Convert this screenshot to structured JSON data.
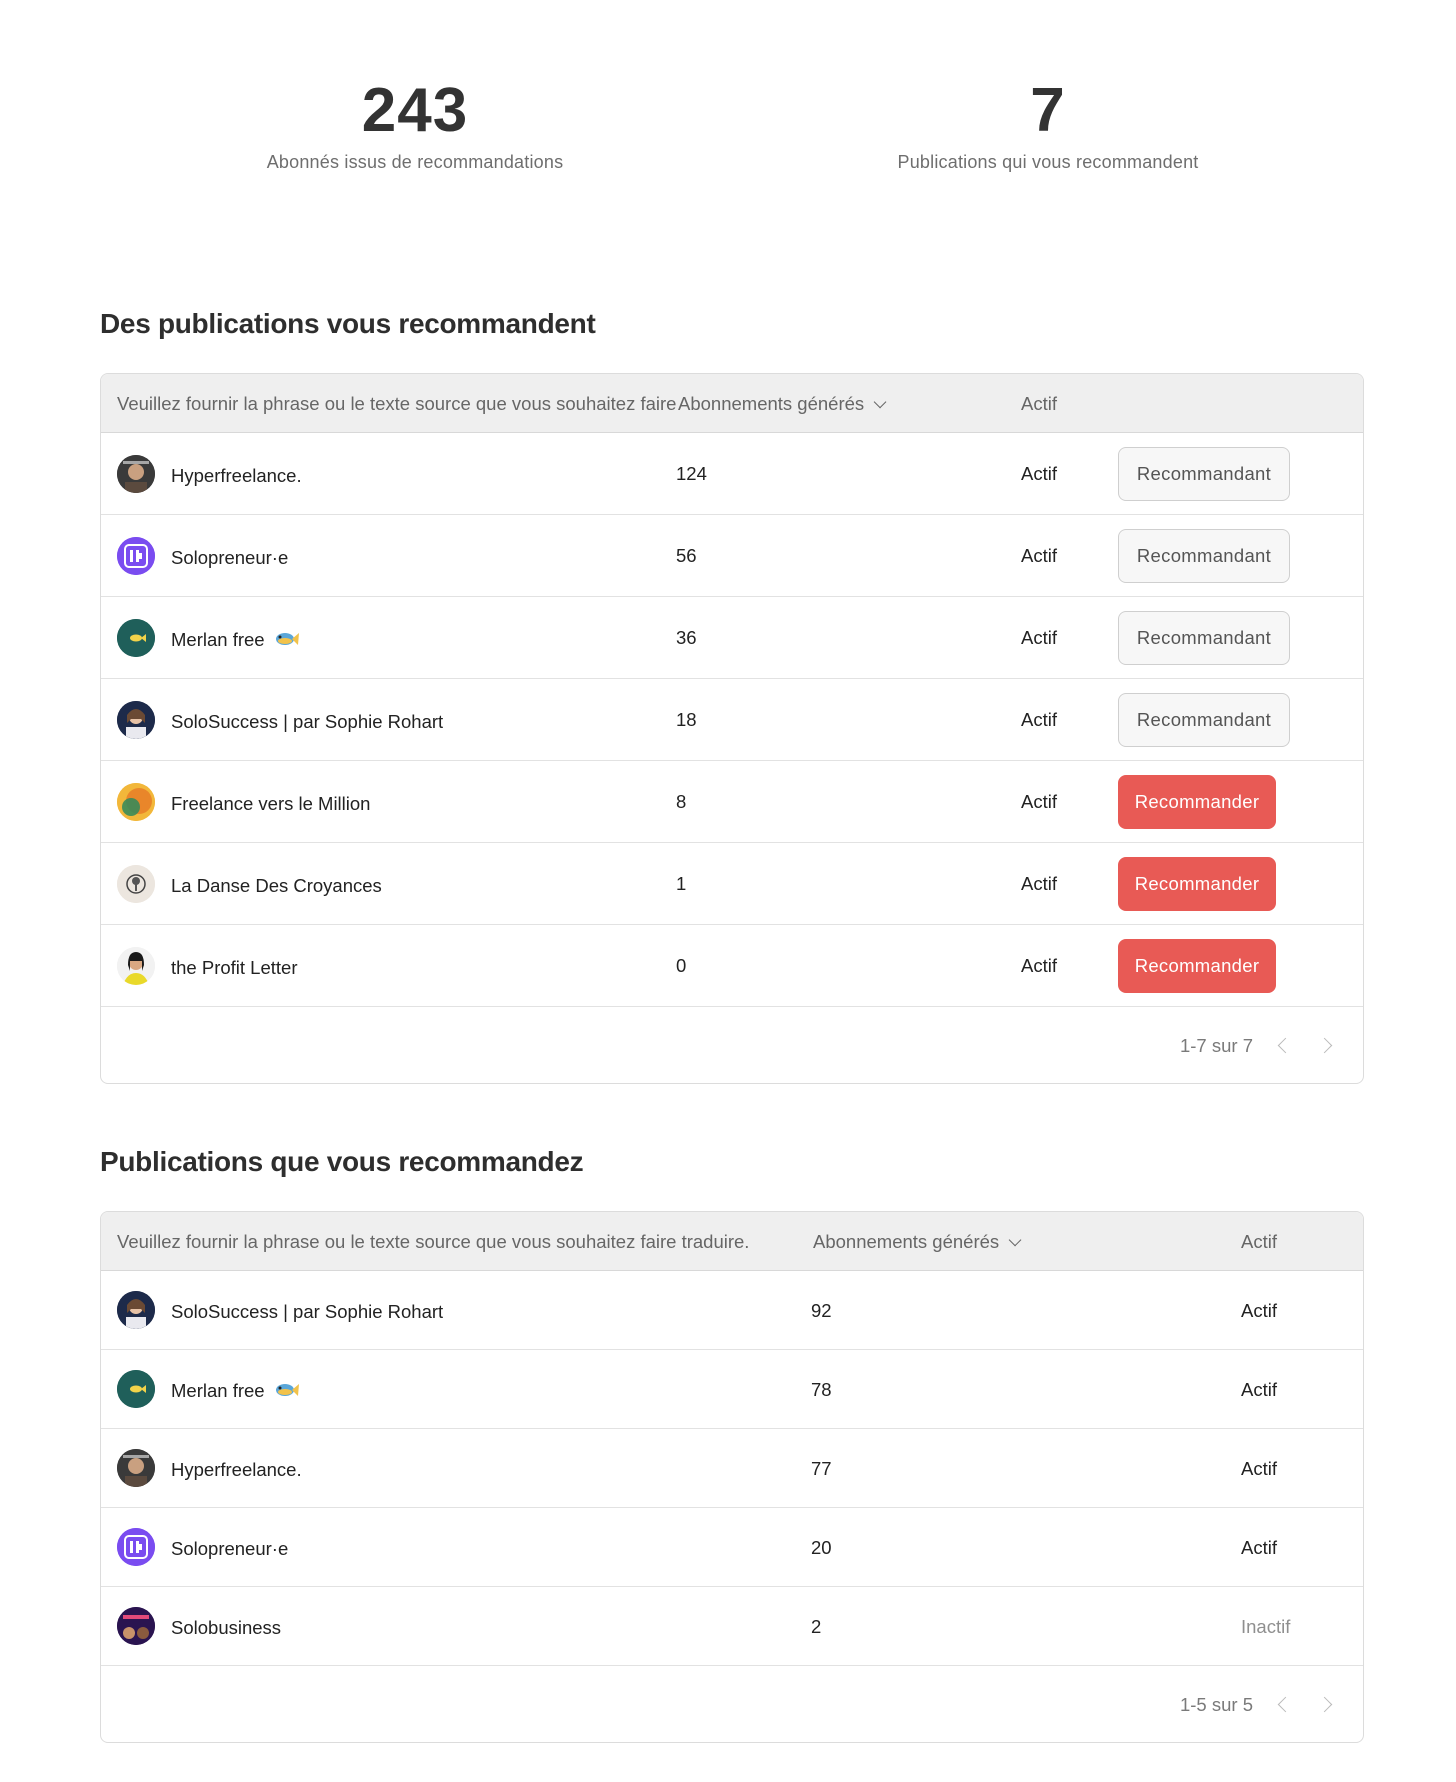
{
  "stats": {
    "referral_subscribers": {
      "value": "243",
      "label": "Abonnés issus de recommandations"
    },
    "recommending_publications": {
      "value": "7",
      "label": "Publications qui vous recommandent"
    }
  },
  "recommending_you": {
    "title": "Des publications vous recommandent",
    "columns": {
      "name": "Veuillez fournir la phrase ou le texte source que vous souhaitez faire traduire.",
      "subs": "Abonnements générés",
      "status": "Actif"
    },
    "rows": [
      {
        "name": "Hyperfreelance.",
        "subs": "124",
        "status": "Actif",
        "button": "Recommandant",
        "avatar": "hyperfreelance-avatar"
      },
      {
        "name": "Solopreneur·e",
        "subs": "56",
        "status": "Actif",
        "button": "Recommandant",
        "avatar": "solopreneure-avatar"
      },
      {
        "name": "Merlan free",
        "subs": "36",
        "status": "Actif",
        "button": "Recommandant",
        "avatar": "merlan-avatar"
      },
      {
        "name": "SoloSuccess | par Sophie Rohart",
        "subs": "18",
        "status": "Actif",
        "button": "Recommandant",
        "avatar": "solosuccess-avatar"
      },
      {
        "name": "Freelance vers le Million",
        "subs": "8",
        "status": "Actif",
        "button": "Recommander",
        "avatar": "freelance-million-avatar"
      },
      {
        "name": "La Danse Des Croyances",
        "subs": "1",
        "status": "Actif",
        "button": "Recommander",
        "avatar": "danse-croyances-avatar"
      },
      {
        "name": "the Profit Letter",
        "subs": "0",
        "status": "Actif",
        "button": "Recommander",
        "avatar": "profit-letter-avatar"
      }
    ],
    "pagination": "1-7 sur 7"
  },
  "you_recommend": {
    "title": "Publications que vous recommandez",
    "columns": {
      "name": "Veuillez fournir la phrase ou le texte source que vous souhaitez faire traduire.",
      "subs": "Abonnements générés",
      "status": "Actif"
    },
    "rows": [
      {
        "name": "SoloSuccess | par Sophie Rohart",
        "subs": "92",
        "status": "Actif"
      },
      {
        "name": "Merlan free",
        "subs": "78",
        "status": "Actif"
      },
      {
        "name": "Hyperfreelance.",
        "subs": "77",
        "status": "Actif"
      },
      {
        "name": "Solopreneur·e",
        "subs": "20",
        "status": "Actif"
      },
      {
        "name": "Solobusiness",
        "subs": "2",
        "status": "Inactif"
      }
    ],
    "pagination": "1-5 sur 5"
  },
  "colors": {
    "accent": "#e85a55",
    "header_bg": "#efefef"
  }
}
